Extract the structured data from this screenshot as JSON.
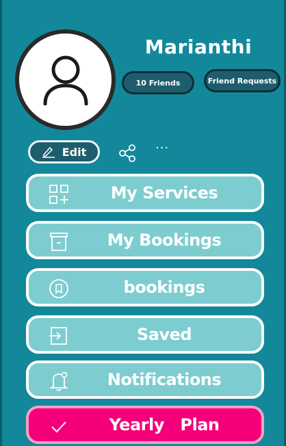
{
  "profile": {
    "name": "Marianthi",
    "friends_label": "10 Friends",
    "requests_label": "Friend Requests"
  },
  "actions": {
    "edit_label": "Edit",
    "more_label": "···"
  },
  "menu": [
    {
      "label": "My Services",
      "icon": "services-grid-icon"
    },
    {
      "label": "My Bookings",
      "icon": "bookings-box-icon"
    },
    {
      "label": "bookings",
      "icon": "bookmark-circle-icon"
    },
    {
      "label": "Saved",
      "icon": "saved-import-icon"
    },
    {
      "label": "Notifications",
      "icon": "bell-icon"
    },
    {
      "label": "Yearly   Plan",
      "icon": "check-icon"
    }
  ],
  "colors": {
    "background": "#13889a",
    "menu_item": "#7dcdd0",
    "active_item": "#f5007a",
    "pill": "#1e5e6c"
  }
}
